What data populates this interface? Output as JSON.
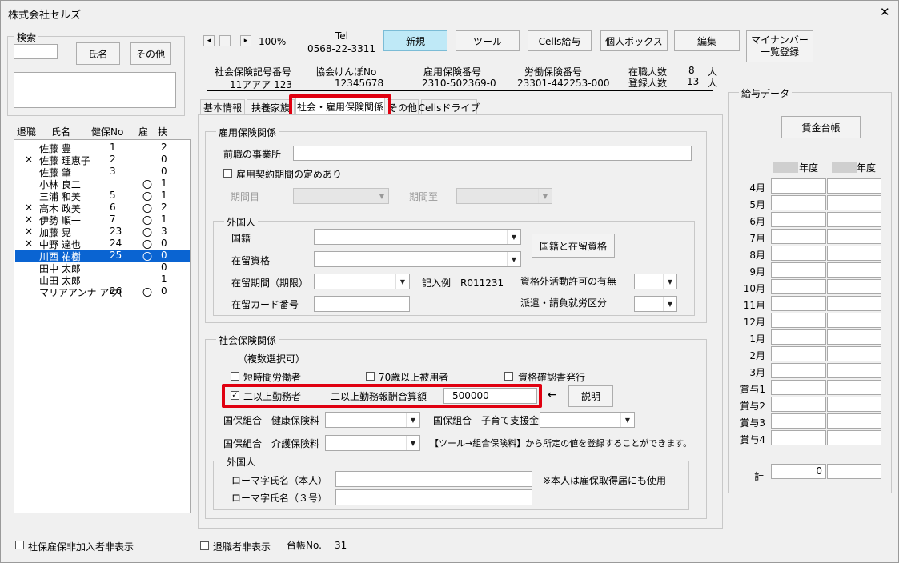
{
  "window": {
    "title": "株式会社セルズ",
    "close_symbol": "✕"
  },
  "search": {
    "title": "検索",
    "name_button": "氏名",
    "other_button": "その他"
  },
  "list": {
    "headers": [
      "退職",
      "氏名",
      "健保No",
      "雇",
      "扶"
    ],
    "rows": [
      {
        "ret": "",
        "name": "佐藤 豊",
        "no": "1",
        "koyo": "",
        "fu": "2"
      },
      {
        "ret": "×",
        "name": "佐藤 理恵子",
        "no": "2",
        "koyo": "",
        "fu": "0"
      },
      {
        "ret": "",
        "name": "佐藤 肇",
        "no": "3",
        "koyo": "",
        "fu": "0"
      },
      {
        "ret": "",
        "name": "小林 良二",
        "no": "",
        "koyo": "〇",
        "fu": "1"
      },
      {
        "ret": "",
        "name": "三浦 和美",
        "no": "5",
        "koyo": "〇",
        "fu": "1"
      },
      {
        "ret": "×",
        "name": "高木 政美",
        "no": "6",
        "koyo": "〇",
        "fu": "2"
      },
      {
        "ret": "×",
        "name": "伊勢 順一",
        "no": "7",
        "koyo": "〇",
        "fu": "1"
      },
      {
        "ret": "×",
        "name": "加藤 晃",
        "no": "23",
        "koyo": "〇",
        "fu": "3"
      },
      {
        "ret": "×",
        "name": "中野 達也",
        "no": "24",
        "koyo": "〇",
        "fu": "0"
      },
      {
        "ret": "",
        "name": "川西 祐樹",
        "no": "25",
        "koyo": "〇",
        "fu": "0"
      },
      {
        "ret": "",
        "name": "田中 太郎",
        "no": "",
        "koyo": "",
        "fu": "0"
      },
      {
        "ret": "",
        "name": "山田 太郎",
        "no": "",
        "koyo": "",
        "fu": "1"
      },
      {
        "ret": "",
        "name": "マリアアンナ アウ(",
        "no": "26",
        "koyo": "〇",
        "fu": "0"
      }
    ],
    "selected_index": 9
  },
  "bottom_left_checkbox": "社保雇保非加入者非表示",
  "zoom": {
    "left": "◂",
    "right": "▸",
    "value": "100%"
  },
  "tel": {
    "label": "Tel",
    "number": "0568-22-3311"
  },
  "toolbar": {
    "new": "新規",
    "tool": "ツール",
    "cells_pay": "Cells給与",
    "personal_box": "個人ボックス",
    "edit": "編集",
    "mynumber_l1": "マイナンバー",
    "mynumber_l2": "一覧登録"
  },
  "info": {
    "shaho_label": "社会保険記号番号",
    "shaho_value": "11アアア 123",
    "kyokai_label": "協会けんぽNo",
    "kyokai_value": "12345678",
    "koyo_label": "雇用保険番号",
    "koyo_value": "2310-502369-0",
    "rodo_label": "労働保険番号",
    "rodo_value": "23301-442253-000",
    "zaishoku_label": "在職人数",
    "zaishoku_value": "8",
    "zaishoku_unit": "人",
    "toroku_label": "登録人数",
    "toroku_value": "13",
    "toroku_unit": "人"
  },
  "tabs": [
    "基本情報",
    "扶養家族",
    "社会・雇用保険関係",
    "その他",
    "Cellsドライブ"
  ],
  "employment": {
    "title": "雇用保険関係",
    "prev_company": "前職の事業所",
    "contract_check": "雇用契約期間の定めあり",
    "period_start": "期間目",
    "period_end": "期間至"
  },
  "foreigner1": {
    "title": "外国人",
    "nationality": "国籍",
    "status": "在留資格",
    "period": "在留期間（期限）",
    "example": "記入例　R011231",
    "card": "在留カード番号",
    "nat_button": "国籍と在留資格",
    "outside_permit": "資格外活動許可の有無",
    "dispatch": "派遣・請負就労区分"
  },
  "social": {
    "title": "社会保険関係",
    "multiple": "（複数選択可）",
    "short_time": "短時間労働者",
    "over70": "70歳以上被用者",
    "cert": "資格確認書発行",
    "two_places": "二以上勤務者",
    "two_places_amount_label": "二以上勤務報酬合算額",
    "two_places_amount": "500000",
    "arrow": "←",
    "explain_button": "説明",
    "kokuho_health": "国保組合　健康保険料",
    "kokuho_child": "国保組合　子育て支援金",
    "kokuho_care": "国保組合　介護保険料",
    "note": "【ツール→組合保険料】から所定の値を登録することができます。"
  },
  "foreigner2": {
    "title": "外国人",
    "roman_self": "ローマ字氏名（本人）",
    "roman_3": "ローマ字氏名（３号）",
    "note": "※本人は雇保取得届にも使用"
  },
  "bottom": {
    "retired_hide": "退職者非表示",
    "ledger_label": "台帳No.",
    "ledger_value": "31"
  },
  "pay": {
    "title": "給与データ",
    "ledger_button": "賃金台帳",
    "year_label": "年度",
    "months": [
      "4月",
      "5月",
      "6月",
      "7月",
      "8月",
      "9月",
      "10月",
      "11月",
      "12月",
      "1月",
      "2月",
      "3月",
      "賞与1",
      "賞与2",
      "賞与3",
      "賞与4"
    ],
    "total_label": "計",
    "total_value": "0"
  }
}
